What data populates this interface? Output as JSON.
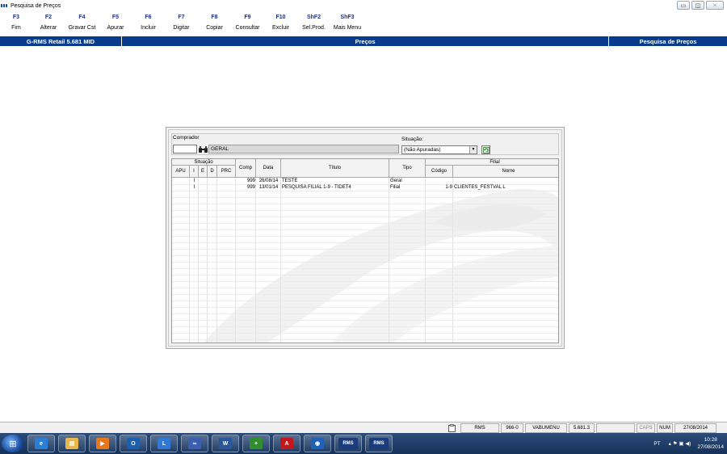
{
  "window": {
    "title": "Pesquisa de Preços",
    "minimize_glyph": "▭",
    "maximize_glyph": "◫",
    "close_glyph": "✕"
  },
  "fkeys": [
    {
      "key": "F3",
      "label": "Fim"
    },
    {
      "key": "F2",
      "label": "Alterar"
    },
    {
      "key": "F4",
      "label": "Gravar Cst"
    },
    {
      "key": "F5",
      "label": "Apurar"
    },
    {
      "key": "F6",
      "label": "Incluir"
    },
    {
      "key": "F7",
      "label": "Digitar"
    },
    {
      "key": "F8",
      "label": "Copiar"
    },
    {
      "key": "F9",
      "label": "Consultar"
    },
    {
      "key": "F10",
      "label": "Excluir"
    },
    {
      "key": "ShF2",
      "label": "Sel.Prod."
    },
    {
      "key": "ShF3",
      "label": "Mais Menu"
    }
  ],
  "header": {
    "left": "G-RMS Retail 5.681 MID",
    "center": "Preços",
    "right": "Pesquisa de Preços"
  },
  "filters": {
    "comprador_label": "Comprador",
    "comprador_code": "",
    "comprador_name": "GERAL",
    "situacao_label": "Situação:",
    "situacao_value": "(Não Apuradas)"
  },
  "grid": {
    "group_situacao": "Situação",
    "group_filial": "Filial",
    "columns": {
      "apu": "APU",
      "i": "I",
      "e": "E",
      "d": "D",
      "prc": "PRC",
      "comp": "Comp",
      "data": "Data",
      "titulo": "Título",
      "tipo": "Tipo",
      "codigo": "Código",
      "nome": "Nome"
    },
    "rows": [
      {
        "apu": "",
        "i": "I",
        "e": "",
        "d": "",
        "prc": "",
        "comp": "999",
        "data": "26/08/14",
        "titulo": "TESTE",
        "tipo": "Geral",
        "codigo": "",
        "nome": ""
      },
      {
        "apu": "",
        "i": "I",
        "e": "",
        "d": "",
        "prc": "",
        "comp": "999",
        "data": "13/01/14",
        "titulo": "PESQUISA FILIAL 1-9 - TIDET4",
        "tipo": "Filial",
        "codigo": "1-9",
        "nome": "CLIENTES_FESTVAL L"
      }
    ]
  },
  "statusbar": {
    "module": "RMS",
    "code": "966-0",
    "menu": "VABUMENU",
    "version": "5.681.3",
    "caps": "CAPS",
    "num": "NUM",
    "date": "27/08/2014"
  },
  "taskbar": {
    "items": [
      {
        "icon": "internet-explorer-icon",
        "glyph": "e",
        "color": "#2a7fd4"
      },
      {
        "icon": "file-explorer-icon",
        "glyph": "▤",
        "color": "#e8b84a"
      },
      {
        "icon": "media-player-icon",
        "glyph": "▶",
        "color": "#e8761b"
      },
      {
        "icon": "outlook-icon",
        "glyph": "O",
        "color": "#1b5fb0"
      },
      {
        "icon": "lync-icon",
        "glyph": "L",
        "color": "#2f7ad6"
      },
      {
        "icon": "network-app-icon",
        "glyph": "∞",
        "color": "#3a5fb0"
      },
      {
        "icon": "word-icon",
        "glyph": "W",
        "color": "#2b579a"
      },
      {
        "icon": "plus-app-icon",
        "glyph": "+",
        "color": "#2f8f2f"
      },
      {
        "icon": "acrobat-icon",
        "glyph": "A",
        "color": "#c4161c"
      },
      {
        "icon": "globe-app-icon",
        "glyph": "◉",
        "color": "#1f62b5"
      },
      {
        "icon": "rms-app-icon",
        "glyph": "RMS",
        "color": "#1a3c7a"
      },
      {
        "icon": "rms-app-icon-2",
        "glyph": "RMS",
        "color": "#1a3c7a"
      }
    ],
    "tray_lang": "PT",
    "tray_icons": "▴  ⚑  ▣  ◀)",
    "clock_time": "10:28",
    "clock_date": "27/08/2014"
  }
}
